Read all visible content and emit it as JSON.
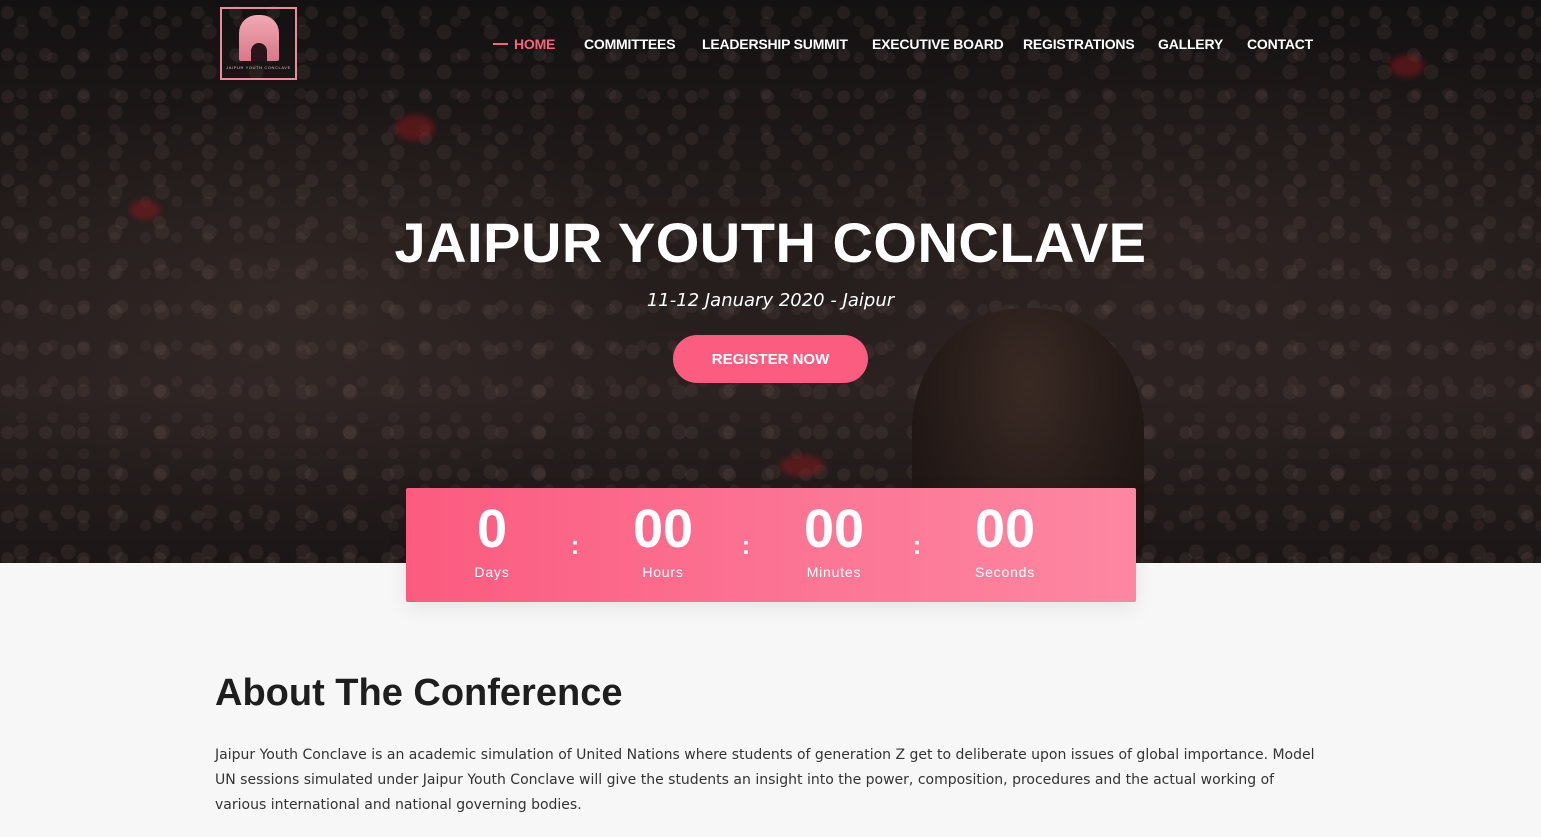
{
  "brand": {
    "logo_caption": "JAIPUR YOUTH CONCLAVE"
  },
  "nav": {
    "items": [
      {
        "label": "HOME",
        "active": true
      },
      {
        "label": "COMMITTEES",
        "active": false
      },
      {
        "label": "LEADERSHIP SUMMIT",
        "active": false
      },
      {
        "label": "EXECUTIVE BOARD",
        "active": false
      },
      {
        "label": "REGISTRATIONS",
        "active": false
      },
      {
        "label": "GALLERY",
        "active": false
      },
      {
        "label": "CONTACT",
        "active": false
      }
    ]
  },
  "hero": {
    "title": "JAIPUR YOUTH CONCLAVE",
    "date_location": "11-12 January 2020 - Jaipur",
    "cta_label": "REGISTER NOW"
  },
  "countdown": {
    "days": {
      "value": "0",
      "label": "Days"
    },
    "hours": {
      "value": "00",
      "label": "Hours"
    },
    "minutes": {
      "value": "00",
      "label": "Minutes"
    },
    "seconds": {
      "value": "00",
      "label": "Seconds"
    },
    "separator": ":"
  },
  "about": {
    "title": "About The Conference",
    "body": "Jaipur Youth Conclave is an academic simulation of United Nations where students of generation Z get to deliberate upon issues of global importance. Model UN sessions simulated under Jaipur Youth Conclave will give the students an insight into the power, composition, procedures and the actual working of various international and national governing bodies."
  },
  "colors": {
    "accent": "#fa5d80",
    "nav_active": "#f4667f",
    "countdown_start": "#fb5b7f",
    "countdown_end": "#fd87a2",
    "page_bg": "#f6f7f6"
  }
}
